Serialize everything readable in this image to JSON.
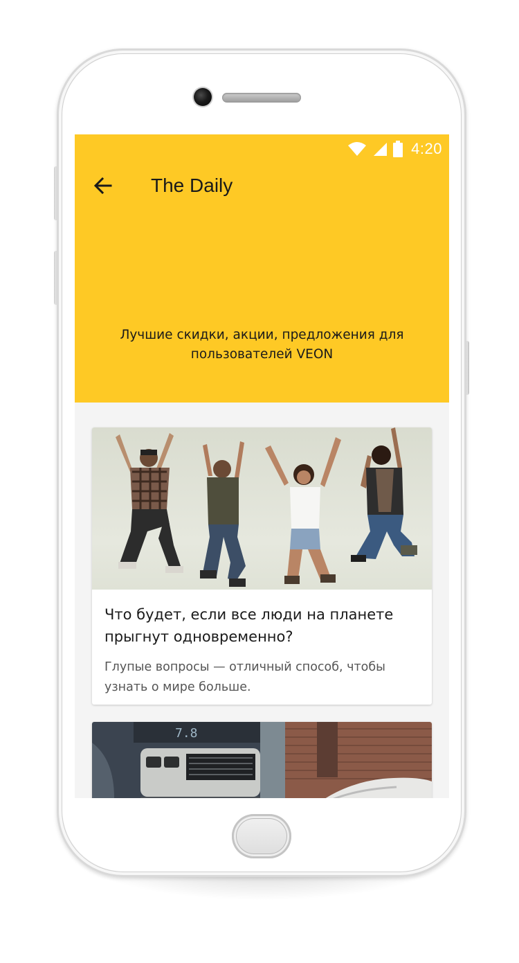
{
  "status_bar": {
    "time": "4:20",
    "icons": [
      "wifi-icon",
      "signal-icon",
      "battery-icon"
    ]
  },
  "toolbar": {
    "back_icon": "arrow-left-icon",
    "title": "The Daily"
  },
  "header": {
    "tagline": "Лучшие скидки, акции, предложения для пользователей VEON",
    "background_color": "#fec925"
  },
  "feed": {
    "cards": [
      {
        "image": "people-jumping-photo",
        "title": "Что будет, если все люди на планете прыгнут одновременно?",
        "description": "Глупые вопросы — отличный способ, чтобы узнать о мире больше."
      },
      {
        "image": "car-interior-and-street-photo"
      }
    ]
  }
}
